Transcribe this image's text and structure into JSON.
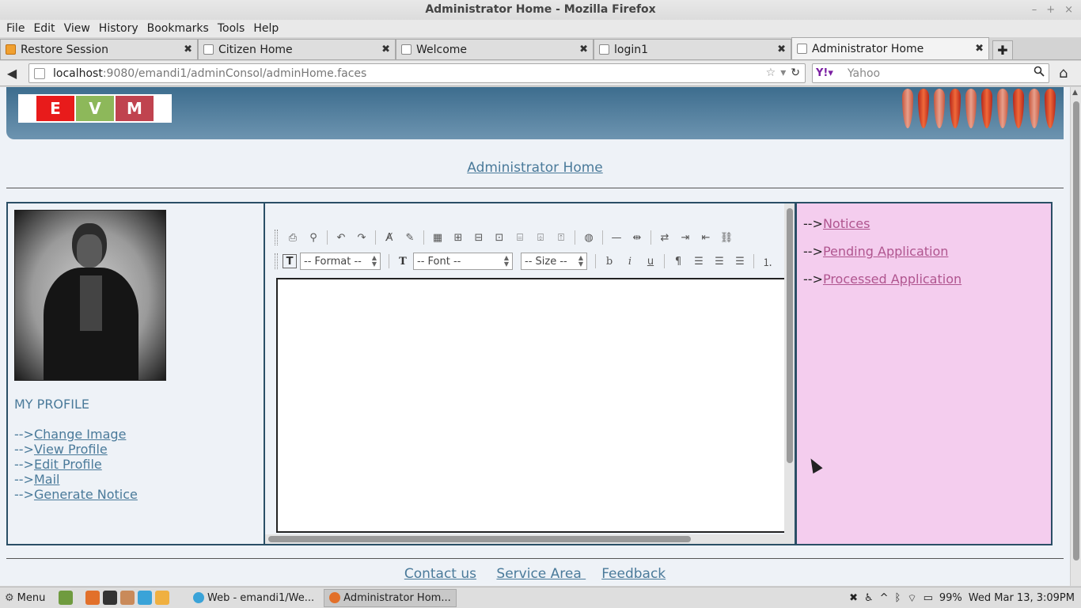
{
  "window": {
    "title": "Administrator Home - Mozilla Firefox",
    "controls": [
      "–",
      "+",
      "×"
    ]
  },
  "menubar": [
    "File",
    "Edit",
    "View",
    "History",
    "Bookmarks",
    "Tools",
    "Help"
  ],
  "tabs": [
    {
      "label": "Restore Session",
      "active": false
    },
    {
      "label": "Citizen Home",
      "active": false
    },
    {
      "label": "Welcome",
      "active": false
    },
    {
      "label": "login1",
      "active": false
    },
    {
      "label": "Administrator Home",
      "active": true
    }
  ],
  "navbar": {
    "url_host": "localhost",
    "url_path": ":9080/emandi1/adminConsol/adminHome.faces",
    "search_placeholder": "Yahoo"
  },
  "page": {
    "logo_letters": [
      "E",
      "V",
      "M"
    ],
    "logo_colors": [
      "#e81b1b",
      "#8db85a",
      "#c0434f"
    ],
    "heading": "Administrator Home",
    "profile_title": "MY PROFILE",
    "link_prefix": "-->",
    "profile_links": [
      "Change Image",
      "View Profile",
      "Edit Profile",
      "Mail",
      "Generate Notice"
    ],
    "right_links": [
      "Notices",
      "Pending Application",
      "Processed Application"
    ],
    "editor": {
      "format_select": "-- Format --",
      "font_select": "-- Font --",
      "size_select": "-- Size --",
      "bold": "b",
      "italic": "i",
      "underline": "u"
    },
    "footer_links": [
      "Contact us",
      "Service Area ",
      "Feedback"
    ]
  },
  "taskbar": {
    "menu_label": "Menu",
    "tasks": [
      {
        "label": "Web - emandi1/We...",
        "active": false
      },
      {
        "label": "Administrator Hom...",
        "active": true
      }
    ],
    "battery": "99%",
    "datetime": "Wed Mar 13,  3:09PM"
  }
}
